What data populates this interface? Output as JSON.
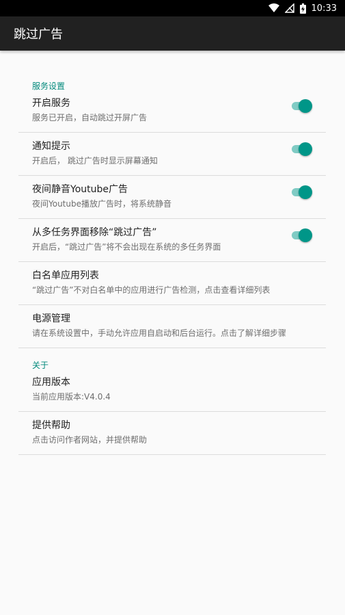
{
  "statusbar": {
    "time": "10:33"
  },
  "appbar": {
    "title": "跳过广告"
  },
  "categories": {
    "service": "服务设置",
    "about": "关于"
  },
  "items": [
    {
      "title": "开启服务",
      "summary": "服务已开启，自动跳过开屏广告",
      "toggle": true
    },
    {
      "title": "通知提示",
      "summary": "开启后， 跳过广告时显示屏幕通知",
      "toggle": true
    },
    {
      "title": "夜间静音Youtube广告",
      "summary": "夜间Youtube播放广告时，将系统静音",
      "toggle": true
    },
    {
      "title": "从多任务界面移除“跳过广告”",
      "summary": "开启后，“跳过广告”将不会出现在系统的多任务界面",
      "toggle": true
    },
    {
      "title": "白名单应用列表",
      "summary": "“跳过广告”不对白名单中的应用进行广告检测，点击查看详细列表"
    },
    {
      "title": "电源管理",
      "summary": "请在系统设置中，手动允许应用自启动和后台运行。点击了解详细步骤"
    },
    {
      "title": "应用版本",
      "summary": "当前应用版本:V4.0.4"
    },
    {
      "title": "提供帮助",
      "summary": "点击访问作者网站，并提供帮助"
    }
  ],
  "colors": {
    "accent": "#009688",
    "appbar": "#212121",
    "category": "#00897b"
  }
}
